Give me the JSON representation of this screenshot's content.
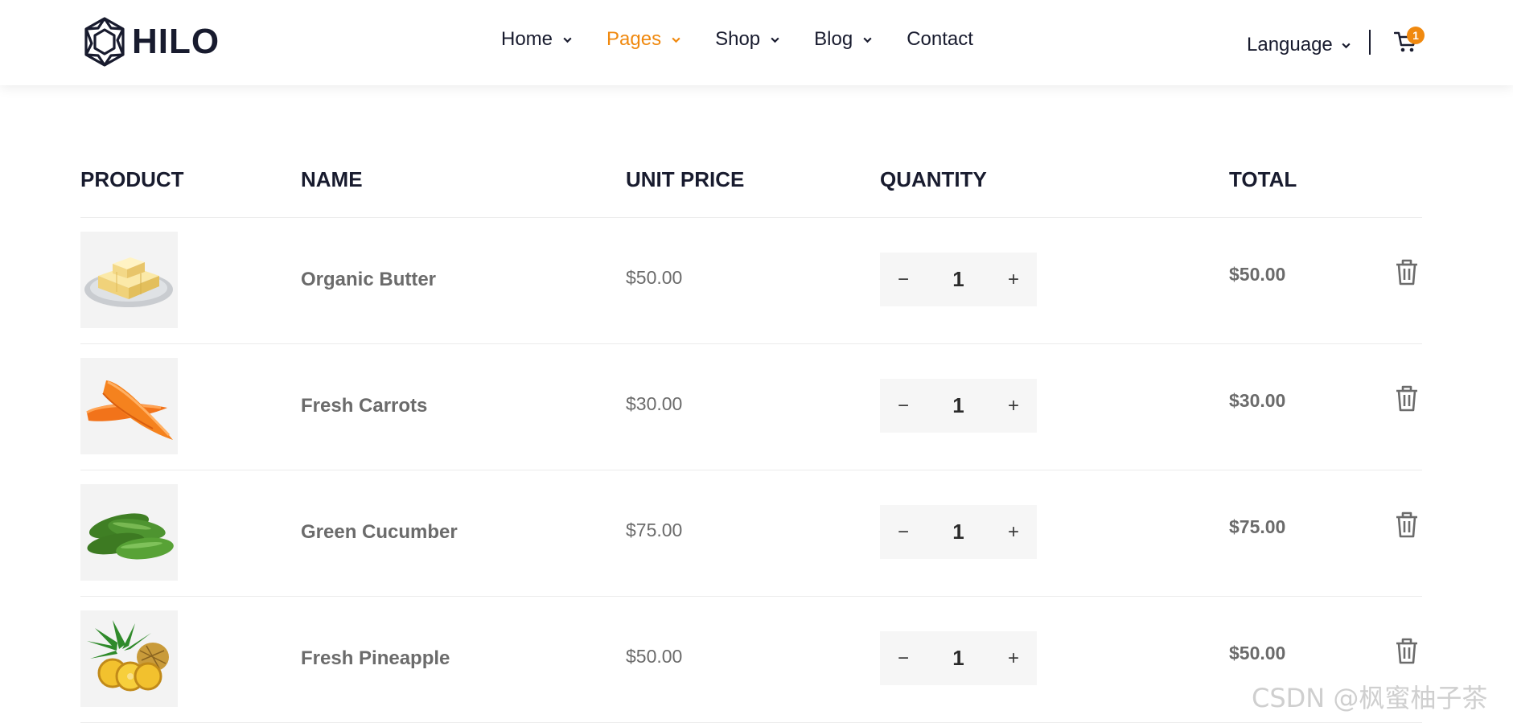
{
  "brand": {
    "name": "HILO"
  },
  "nav": {
    "items": [
      {
        "label": "Home",
        "active": false,
        "has_dropdown": true
      },
      {
        "label": "Pages",
        "active": true,
        "has_dropdown": true
      },
      {
        "label": "Shop",
        "active": false,
        "has_dropdown": true
      },
      {
        "label": "Blog",
        "active": false,
        "has_dropdown": true
      },
      {
        "label": "Contact",
        "active": false,
        "has_dropdown": false
      }
    ],
    "language_label": "Language",
    "cart_count": "1",
    "accent_color": "#f0890f"
  },
  "table": {
    "headers": [
      "PRODUCT",
      "NAME",
      "UNIT PRICE",
      "QUANTITY",
      "TOTAL"
    ],
    "rows": [
      {
        "image": "butter-image",
        "name": "Organic Butter",
        "unit_price": "$50.00",
        "qty_minus": "−",
        "quantity": "1",
        "qty_plus": "+",
        "total": "$50.00",
        "remove_icon": "trash-icon"
      },
      {
        "image": "carrots-image",
        "name": "Fresh Carrots",
        "unit_price": "$30.00",
        "qty_minus": "−",
        "quantity": "1",
        "qty_plus": "+",
        "total": "$30.00",
        "remove_icon": "trash-icon"
      },
      {
        "image": "cucumber-image",
        "name": "Green Cucumber",
        "unit_price": "$75.00",
        "qty_minus": "−",
        "quantity": "1",
        "qty_plus": "+",
        "total": "$75.00",
        "remove_icon": "trash-icon"
      },
      {
        "image": "pineapple-image",
        "name": "Fresh Pineapple",
        "unit_price": "$50.00",
        "qty_minus": "−",
        "quantity": "1",
        "qty_plus": "+",
        "total": "$50.00",
        "remove_icon": "trash-icon"
      }
    ]
  },
  "watermark": "CSDN @枫蜜柚子茶"
}
